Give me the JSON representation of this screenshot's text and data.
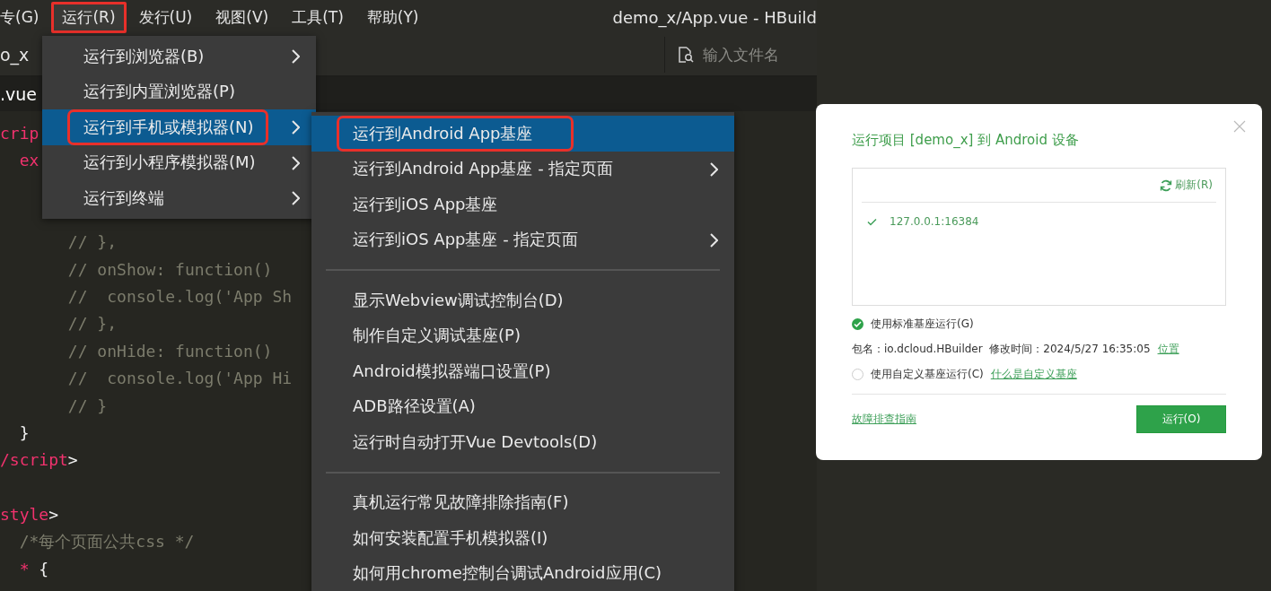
{
  "menubar": {
    "items": [
      {
        "label": "专(G)",
        "selected": false,
        "marked": false
      },
      {
        "label": "运行(R)",
        "selected": true,
        "marked": true
      },
      {
        "label": "发行(U)",
        "selected": false,
        "marked": false
      },
      {
        "label": "视图(V)",
        "selected": false,
        "marked": false
      },
      {
        "label": "工具(T)",
        "selected": false,
        "marked": false
      },
      {
        "label": "帮助(Y)",
        "selected": false,
        "marked": false
      }
    ],
    "title": "demo_x/App.vue - HBuild"
  },
  "editor_tab": {
    "label": "o_x"
  },
  "file_search": {
    "placeholder": "输入文件名"
  },
  "open_file": {
    "label": ".vue"
  },
  "code_lines": [
    {
      "kind": "code",
      "segments": [
        {
          "text": "crip",
          "kind": "tag"
        }
      ]
    },
    {
      "kind": "code",
      "segments": [
        {
          "text": "  ex",
          "kind": "tag"
        }
      ]
    },
    {
      "kind": "blank"
    },
    {
      "kind": "blank"
    },
    {
      "kind": "code",
      "segments": [
        {
          "text": "       // },",
          "kind": "comment"
        }
      ]
    },
    {
      "kind": "code",
      "segments": [
        {
          "text": "       // onShow: function()",
          "kind": "comment"
        }
      ]
    },
    {
      "kind": "code",
      "segments": [
        {
          "text": "       //  console.log('App Sh",
          "kind": "comment"
        }
      ]
    },
    {
      "kind": "code",
      "segments": [
        {
          "text": "       // },",
          "kind": "comment"
        }
      ]
    },
    {
      "kind": "code",
      "segments": [
        {
          "text": "       // onHide: function()",
          "kind": "comment"
        }
      ]
    },
    {
      "kind": "code",
      "segments": [
        {
          "text": "       //  console.log('App Hi",
          "kind": "comment"
        }
      ]
    },
    {
      "kind": "code",
      "segments": [
        {
          "text": "       // }",
          "kind": "comment"
        }
      ]
    },
    {
      "kind": "code",
      "segments": [
        {
          "text": "  }",
          "kind": "plain"
        }
      ]
    },
    {
      "kind": "code",
      "segments": [
        {
          "text": "/script",
          "kind": "tag"
        },
        {
          "text": ">",
          "kind": "plain"
        }
      ]
    },
    {
      "kind": "blank"
    },
    {
      "kind": "code",
      "segments": [
        {
          "text": "style",
          "kind": "tag"
        },
        {
          "text": ">",
          "kind": "plain"
        }
      ]
    },
    {
      "kind": "code",
      "segments": [
        {
          "text": "  /*每个页面公共css */",
          "kind": "comment"
        }
      ]
    },
    {
      "kind": "code",
      "segments": [
        {
          "text": "  *",
          "kind": "tag"
        },
        {
          "text": " {",
          "kind": "plain"
        }
      ]
    }
  ],
  "menus": [
    {
      "items": [
        {
          "label": "运行到浏览器(B)",
          "submenu": true,
          "selected": false,
          "marked": false
        },
        {
          "label": "运行到内置浏览器(P)",
          "submenu": false,
          "selected": false,
          "marked": false
        },
        {
          "label": "运行到手机或模拟器(N)",
          "submenu": true,
          "selected": true,
          "marked": true
        },
        {
          "label": "运行到小程序模拟器(M)",
          "submenu": true,
          "selected": false,
          "marked": false
        },
        {
          "label": "运行到终端",
          "submenu": true,
          "selected": false,
          "marked": false
        }
      ]
    },
    {
      "items": [
        {
          "kind": "item",
          "label": "运行到Android App基座",
          "submenu": false,
          "selected": true,
          "marked": true
        },
        {
          "kind": "item",
          "label": "运行到Android App基座 - 指定页面",
          "submenu": true,
          "selected": false,
          "marked": false
        },
        {
          "kind": "item",
          "label": "运行到iOS App基座",
          "submenu": false,
          "selected": false,
          "marked": false
        },
        {
          "kind": "item",
          "label": "运行到iOS App基座 - 指定页面",
          "submenu": true,
          "selected": false,
          "marked": false
        },
        {
          "kind": "separator"
        },
        {
          "kind": "item",
          "label": "显示Webview调试控制台(D)",
          "submenu": false,
          "selected": false,
          "marked": false
        },
        {
          "kind": "item",
          "label": "制作自定义调试基座(P)",
          "submenu": false,
          "selected": false,
          "marked": false
        },
        {
          "kind": "item",
          "label": "Android模拟器端口设置(P)",
          "submenu": false,
          "selected": false,
          "marked": false
        },
        {
          "kind": "item",
          "label": "ADB路径设置(A)",
          "submenu": false,
          "selected": false,
          "marked": false
        },
        {
          "kind": "item",
          "label": "运行时自动打开Vue Devtools(D)",
          "submenu": false,
          "selected": false,
          "marked": false
        },
        {
          "kind": "separator"
        },
        {
          "kind": "item",
          "label": "真机运行常见故障排除指南(F)",
          "submenu": false,
          "selected": false,
          "marked": false
        },
        {
          "kind": "item",
          "label": "如何安装配置手机模拟器(I)",
          "submenu": false,
          "selected": false,
          "marked": false
        },
        {
          "kind": "item",
          "label": "如何用chrome控制台调试Android应用(C)",
          "submenu": false,
          "selected": false,
          "marked": false
        }
      ]
    }
  ],
  "dialog": {
    "title": "运行项目 [demo_x] 到 Android 设备",
    "refresh": "刷新(R)",
    "devices": [
      {
        "address": "127.0.0.1:16384",
        "checked": true
      }
    ],
    "options": [
      {
        "label": "使用标准基座运行(G)",
        "selected": true,
        "detail": "包名：io.dcloud.HBuilder  修改时间：2024/5/27 16:35:05",
        "link": "位置"
      },
      {
        "label": "使用自定义基座运行(C)",
        "selected": false,
        "link": "什么是自定义基座"
      }
    ],
    "help_link": "故障排查指南",
    "run_button": "运行(O)"
  }
}
